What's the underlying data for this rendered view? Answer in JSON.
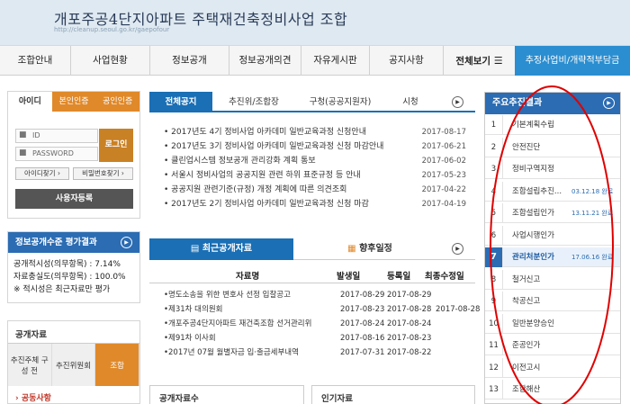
{
  "header": {
    "title": "개포주공4단지아파트 주택재건축정비사업 조합",
    "url": "http://cleanup.seoul.go.kr/gaepofour"
  },
  "gnb": {
    "items": [
      "조합안내",
      "사업현황",
      "정보공개",
      "정보공개의견",
      "자유게시판",
      "공지사항"
    ],
    "all_label": "전체보기",
    "special_label": "추정사업비/개략적부담금"
  },
  "login": {
    "tabs": [
      "아이디",
      "본인인증",
      "공인인증"
    ],
    "id_placeholder": "ID",
    "pw_placeholder": "PASSWORD",
    "login_label": "로그인",
    "find_id": "아이디찾기",
    "find_pw": "비밀번호찾기",
    "register": "사용자등록"
  },
  "eval": {
    "title": "정보공개수준 평가결과",
    "rows": [
      "공개적시성(의무항목) : 7.14%",
      "자료충실도(의무항목) : 100.0%",
      "※ 적시성은 최근자료만 평가"
    ]
  },
  "pubdata": {
    "title": "공개자료",
    "tabs": [
      "추진주체 구성 전",
      "추진위원회",
      "조합"
    ],
    "sub": "공동사항"
  },
  "notice": {
    "tabs": [
      "전체공지",
      "추진위/조합장",
      "구청(공공지원자)",
      "시청"
    ],
    "items": [
      {
        "title": "2017년도 4기 정비사업 아카데미 일반교육과정 신청안내",
        "date": "2017-08-17"
      },
      {
        "title": "2017년도 3기 정비사업 아카데미 일반교육과정 신청 마감안내",
        "date": "2017-06-21"
      },
      {
        "title": "클린업시스템 정보공개 관리강화 계획 통보",
        "date": "2017-06-02"
      },
      {
        "title": "서울시 정비사업의 공공지원 관련 하위 표준규정 등 안내",
        "date": "2017-05-23"
      },
      {
        "title": "공공지원 관련기준(규정) 개정 계획에 따른 의견조회",
        "date": "2017-04-22"
      },
      {
        "title": "2017년도 2기 정비사업 아카데미 일반교육과정 신청 마감",
        "date": "2017-04-19"
      }
    ]
  },
  "recent": {
    "tabs": [
      "최근공개자료",
      "향후일정"
    ],
    "columns": [
      "자료명",
      "발생일",
      "등록일",
      "최종수정일"
    ],
    "rows": [
      {
        "name": "명도소송을 위한 변호사 선정 입찰공고",
        "occur": "2017-08-29",
        "reg": "2017-08-29",
        "mod": ""
      },
      {
        "name": "제31차 대의원회",
        "occur": "2017-08-23",
        "reg": "2017-08-28",
        "mod": "2017-08-28"
      },
      {
        "name": "개포주공4단지아파트 재건축조합 선거관리위",
        "occur": "2017-08-24",
        "reg": "2017-08-24",
        "mod": ""
      },
      {
        "name": "제91차 이사회",
        "occur": "2017-08-16",
        "reg": "2017-08-23",
        "mod": ""
      },
      {
        "name": "2017년 07월 월별자금 입·출금세부내역",
        "occur": "2017-07-31",
        "reg": "2017-08-22",
        "mod": ""
      }
    ],
    "bottom_left": "공개자료수",
    "bottom_right": "인기자료"
  },
  "result": {
    "title": "주요추진결과",
    "items": [
      {
        "num": "1",
        "label": "기본계획수립",
        "date": ""
      },
      {
        "num": "2",
        "label": "안전진단",
        "date": ""
      },
      {
        "num": "3",
        "label": "정비구역지정",
        "date": ""
      },
      {
        "num": "4",
        "label": "조합설립추진...",
        "date": "03.12.18 완료"
      },
      {
        "num": "5",
        "label": "조합설립인가",
        "date": "13.11.21 완료"
      },
      {
        "num": "6",
        "label": "사업시행인가",
        "date": ""
      },
      {
        "num": "7",
        "label": "관리처분인가",
        "date": "17.06.16 완료"
      },
      {
        "num": "8",
        "label": "철거신고",
        "date": ""
      },
      {
        "num": "9",
        "label": "착공신고",
        "date": ""
      },
      {
        "num": "10",
        "label": "일반분양승인",
        "date": ""
      },
      {
        "num": "11",
        "label": "준공인가",
        "date": ""
      },
      {
        "num": "12",
        "label": "이전고시",
        "date": ""
      },
      {
        "num": "13",
        "label": "조합해산",
        "date": ""
      }
    ],
    "current_index": 7
  },
  "colors": {
    "accent": "#1a6fb5",
    "orange": "#e0892a",
    "annotation": "#e00000"
  }
}
